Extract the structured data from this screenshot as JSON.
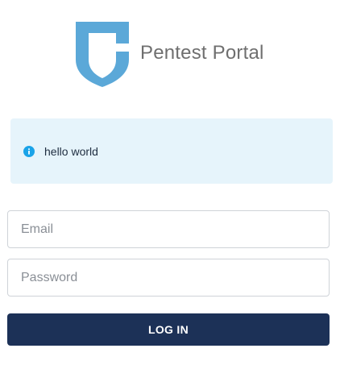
{
  "brand": {
    "name": "Pentest Portal",
    "logo_icon": "shield-icon",
    "logo_color": "#5ba8d8"
  },
  "alert": {
    "icon": "info-icon",
    "icon_color": "#1aa3e8",
    "message": "hello world",
    "background": "#e6f4fb"
  },
  "form": {
    "email_placeholder": "Email",
    "email_value": "",
    "password_placeholder": "Password",
    "password_value": "",
    "login_label": "LOG IN",
    "login_color": "#1c3157"
  }
}
